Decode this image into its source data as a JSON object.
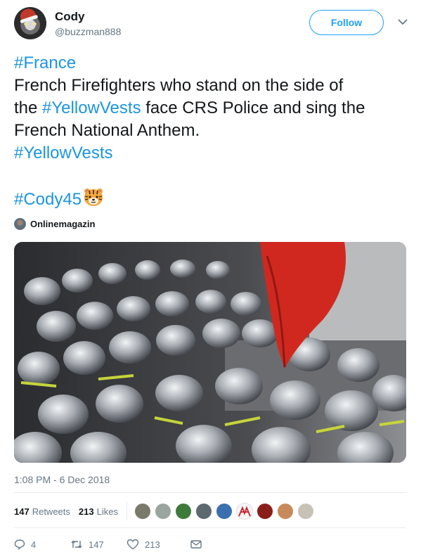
{
  "header": {
    "display_name": "Cody",
    "handle": "@buzzman888",
    "follow_label": "Follow",
    "avatar_icon": "tiger-santa-hat-avatar",
    "menu_icon": "chevron-down-icon"
  },
  "tweet": {
    "line1_hashtag": "#France",
    "line2_text": "French Firefighters who stand on the side of",
    "line3_pre": "the ",
    "line3_hashtag": "#YellowVests",
    "line3_post": " face CRS Police and sing the",
    "line4_text": "French National Anthem.",
    "line5_hashtag": "#YellowVests",
    "line7_hashtag": "#Cody45",
    "emoji": "tiger-face-icon"
  },
  "attribution": {
    "name": "Onlinemagazin"
  },
  "timestamp": "1:08 PM - 6 Dec 2018",
  "stats": {
    "retweets_count": "147",
    "retweets_label": "Retweets",
    "likes_count": "213",
    "likes_label": "Likes",
    "liker_avatar_count": 10
  },
  "actions": {
    "reply_count": "4",
    "retweet_count": "147",
    "like_count": "213"
  },
  "colors": {
    "accent": "#1da1f2",
    "hashtag": "#1b95e0",
    "muted": "#657786",
    "text": "#14171a"
  }
}
